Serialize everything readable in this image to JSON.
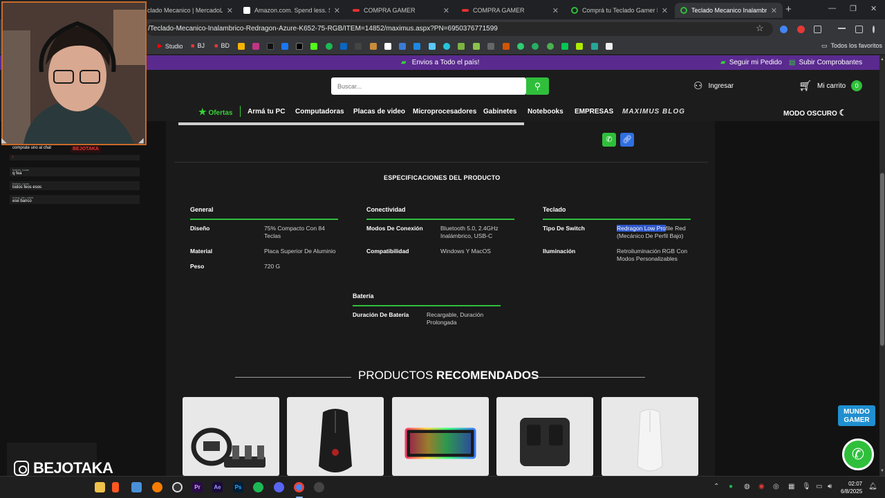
{
  "browser": {
    "tabs": [
      {
        "title": "clado Mecanico | MercadoLib",
        "active": false,
        "icon_color": "#ffe600"
      },
      {
        "title": "Amazon.com. Spend less. Smil",
        "active": false,
        "icon_color": "#ffffff"
      },
      {
        "title": "COMPRA GAMER",
        "active": false,
        "icon_color": "#e0312f"
      },
      {
        "title": "COMPRA GAMER",
        "active": false,
        "icon_color": "#e0312f"
      },
      {
        "title": "Comprá tu Teclado Gamer Mec",
        "active": false,
        "icon_color": "#2fbf3b"
      },
      {
        "title": "Teclado Mecanico Inalambrico",
        "active": true,
        "icon_color": "#2fbf3b"
      }
    ],
    "new_tab_label": "+",
    "url": "/Teclado-Mecanico-Inalambrico-Redragon-Azure-K652-75-RGB/ITEM=14852/maximus.aspx?PN=6950376771599",
    "bookmarks": [
      {
        "label": "Studio",
        "icon_color": "#ff0000"
      },
      {
        "label": "BJ",
        "icon_color": "#e53935"
      },
      {
        "label": "BD",
        "icon_color": "#e53935"
      }
    ],
    "all_favorites_label": "Todos los favoritos"
  },
  "site": {
    "promo_text": "Envios a Todo el país!",
    "track_order": "Seguir mi Pedido",
    "upload_receipts": "Subir Comprobantes",
    "search_placeholder": "Buscar...",
    "login_label": "Ingresar",
    "cart_label": "Mi carrito",
    "cart_count": "0",
    "nav": {
      "ofertas": "Ofertas",
      "arma_pc": "Armá tu PC",
      "computadoras": "Computadoras",
      "placas_video": "Placas de video",
      "microprocesadores": "Microprocesadores",
      "gabinetes": "Gabinetes",
      "notebooks": "Notebooks",
      "empresas": "EMPRESAS",
      "blog": "MAXIMUS BLOG",
      "dark_mode": "MODO OSCURO"
    },
    "specs_title": "ESPECIFICACIONES DEL PRODUCTO",
    "spec_groups": {
      "general": {
        "title": "General",
        "rows": [
          {
            "key": "Diseño",
            "value": "75% Compacto Con 84 Teclas"
          },
          {
            "key": "Material",
            "value": "Placa Superior De Aluminio"
          },
          {
            "key": "Peso",
            "value": "720 G"
          }
        ]
      },
      "conectividad": {
        "title": "Conectividad",
        "rows": [
          {
            "key": "Modos De Conexión",
            "value": "Bluetooth 5.0, 2.4GHz Inalámbrico, USB-C"
          },
          {
            "key": "Compatibilidad",
            "value": "Windows Y MacOS"
          }
        ]
      },
      "teclado": {
        "title": "Teclado",
        "rows": [
          {
            "key": "Tipo De Switch",
            "value_highlight": "Redragon Low Pro",
            "value_rest": "file Red (Mecánico De Perfil Bajo)"
          },
          {
            "key": "Iluminación",
            "value": "Retroiluminación RGB Con Modos Personalizables"
          }
        ]
      },
      "bateria": {
        "title": "Batería",
        "rows": [
          {
            "key": "Duración De Batería",
            "value": "Recargable, Duración Prolongada"
          }
        ]
      }
    },
    "recommended_title_light": "PRODUCTOS",
    "recommended_title_bold": "RECOMENDADOS",
    "recommended_products": [
      {
        "name": "steering-wheel-set"
      },
      {
        "name": "wireless-mouse"
      },
      {
        "name": "rgb-keyboard"
      },
      {
        "name": "wireless-mic-kit"
      },
      {
        "name": "white-mouse"
      }
    ],
    "floating_logo": "MUNDO GAMER"
  },
  "overlay": {
    "chat_badge": "BEJOTAKA",
    "chat_messages": [
      {
        "user": "",
        "text": "comprate uno al chat"
      },
      {
        "user": "",
        "text": "!"
      },
      {
        "user": "fosforo_lucas",
        "text": "q fea"
      },
      {
        "user": "fosforo_lucas",
        "text": "todos feos esos"
      },
      {
        "user": "nosoy_tan_crack",
        "text": "ese banco"
      }
    ],
    "instagram_handle": "BEJOTAKA"
  },
  "taskbar": {
    "time": "02:07",
    "date": "6/8/2025"
  }
}
